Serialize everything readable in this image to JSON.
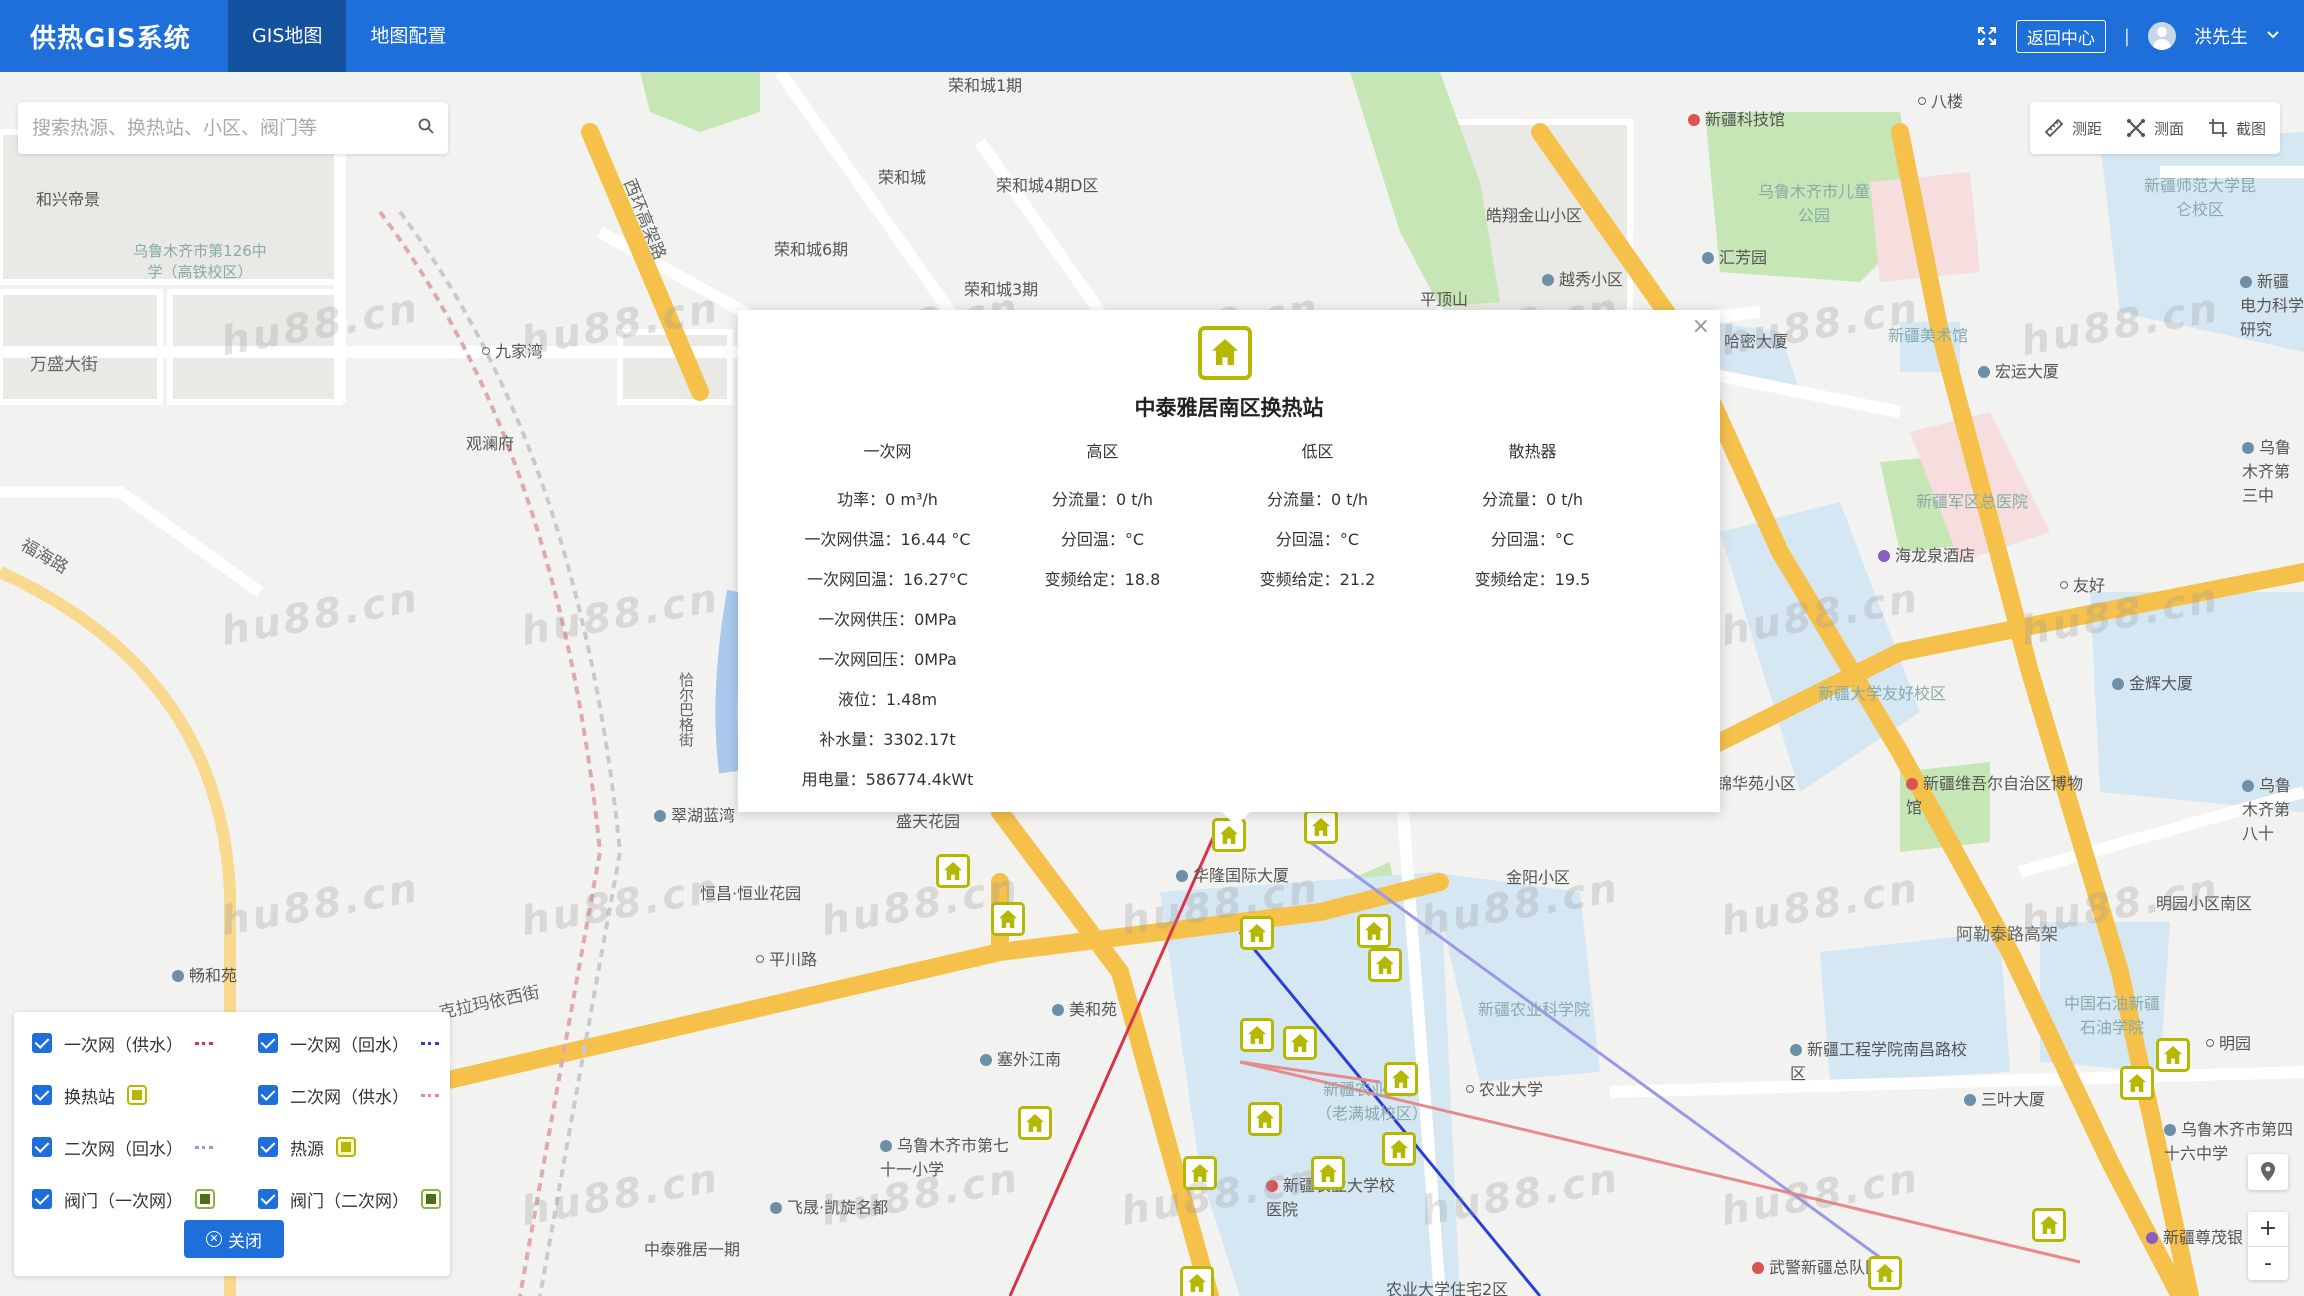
{
  "app": {
    "title": "供热GIS系统"
  },
  "nav": {
    "items": [
      {
        "label": "GIS地图",
        "active": true
      },
      {
        "label": "地图配置",
        "active": false
      }
    ]
  },
  "header": {
    "return_label": "返回中心",
    "separator": "|",
    "user_name": "洪先生"
  },
  "search": {
    "placeholder": "搜索热源、换热站、小区、阀门等"
  },
  "tools": {
    "measure_distance": "测距",
    "measure_area": "测面",
    "screenshot": "截图"
  },
  "popup": {
    "title": "中泰雅居南区换热站",
    "close": "×",
    "columns": [
      {
        "header": "一次网",
        "rows": [
          "功率：0 m³/h",
          "一次网供温：16.44 °C",
          "一次网回温：16.27°C",
          "一次网供压：0MPa",
          "一次网回压：0MPa",
          "液位：1.48m",
          "补水量：3302.17t",
          "用电量：586774.4kWt"
        ]
      },
      {
        "header": "高区",
        "rows": [
          "分流量：0 t/h",
          "分回温：°C",
          "变频给定：18.8"
        ]
      },
      {
        "header": "低区",
        "rows": [
          "分流量：0 t/h",
          "分回温：°C",
          "变频给定：21.2"
        ]
      },
      {
        "header": "散热器",
        "rows": [
          "分流量：0 t/h",
          "分回温：°C",
          "变频给定：19.5"
        ]
      }
    ]
  },
  "legend": {
    "items": [
      {
        "label": "一次网（供水）",
        "symbol": "line",
        "color": "#d9334a"
      },
      {
        "label": "一次网（回水）",
        "symbol": "line",
        "color": "#2a3fd6"
      },
      {
        "label": "换热站",
        "symbol": "station"
      },
      {
        "label": "二次网（供水）",
        "symbol": "line",
        "color": "#e88a8a"
      },
      {
        "label": "二次网（回水）",
        "symbol": "line",
        "color": "#9a98e8"
      },
      {
        "label": "热源",
        "symbol": "source"
      },
      {
        "label": "阀门（一次网）",
        "symbol": "valve"
      },
      {
        "label": "阀门（二次网）",
        "symbol": "valve"
      }
    ],
    "close_label": "关闭"
  },
  "zoom": {
    "in": "+",
    "out": "-"
  },
  "map_labels": [
    "荣和城1期",
    "荣和城",
    "荣和城4期D区",
    "荣和城6期",
    "荣和城3期",
    "和兴帝景",
    "乌鲁木齐市第126中学（高铁校区）",
    "九家湾",
    "万盛大街",
    "观澜府",
    "西环高架路",
    "福海路",
    "恰尔巴格街",
    "翠湖蓝湾",
    "盛天花园",
    "恒昌·恒业花园",
    "平川路",
    "畅和苑",
    "美和苑",
    "塞外江南",
    "乌鲁木齐市第七十一小学",
    "飞晟·凯旋名都",
    "中泰雅居一期",
    "克拉玛依西街",
    "华隆国际大厦",
    "金阳小区",
    "新疆农业科学院",
    "新疆农业大学（老满城校区）",
    "农业大学",
    "新疆农业大学校医院",
    "农业大学住宅2区",
    "皓翔金山小区",
    "平顶山",
    "越秀小区",
    "新疆科技馆",
    "乌鲁木齐市儿童公园",
    "汇芳园",
    "哈密大厦",
    "新疆美术馆",
    "宏运大厦",
    "新疆军区总医院",
    "海龙泉酒店",
    "友好",
    "新疆大学友好校区",
    "金辉大厦",
    "锦华苑小区",
    "新疆维吾尔自治区博物馆",
    "明园小区南区",
    "阿勒泰路高架",
    "新疆工程学院南昌路校区",
    "三叶大厦",
    "明园",
    "乌鲁木齐市第四十六中学",
    "武警新疆总队医院",
    "新疆尊茂银",
    "中国石油新疆石油学院",
    "新疆师范大学昆仑校区",
    "八楼",
    "新疆电力科学研究",
    "乌鲁木齐第三中",
    "乌鲁木齐第八十"
  ],
  "watermark": "hu88.cn"
}
